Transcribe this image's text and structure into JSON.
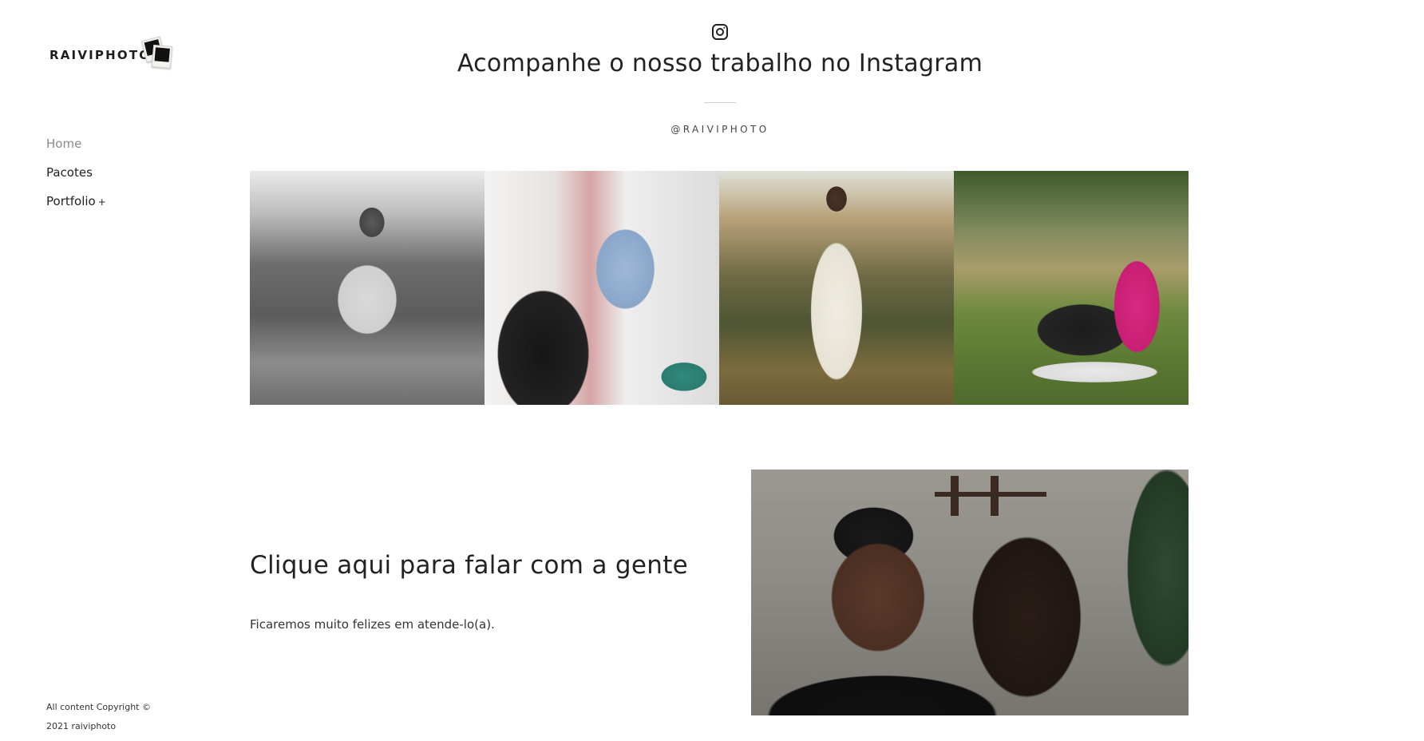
{
  "sidebar": {
    "logo_text": "RAIVIPHOTO",
    "nav": [
      {
        "label": "Home",
        "active": true
      },
      {
        "label": "Pacotes",
        "active": false
      },
      {
        "label": "Portfolio",
        "active": false,
        "expand": "+"
      }
    ],
    "copyright_line1": "All content Copyright ©",
    "copyright_line2": "2021 raiviphoto"
  },
  "instagram": {
    "icon": "instagram-icon",
    "title": "Acompanhe o nosso trabalho no Instagram",
    "handle": "@RAIVIPHOTO",
    "photos": [
      {
        "name": "bw-woman-white-dress"
      },
      {
        "name": "mother-lifting-baby"
      },
      {
        "name": "woman-white-dress-field"
      },
      {
        "name": "couple-sitting-grass"
      }
    ]
  },
  "contact": {
    "title": "Clique aqui para falar com a gente",
    "subtitle": "Ficaremos muito felizes em atende-lo(a).",
    "photo": "couple-smiling"
  }
}
